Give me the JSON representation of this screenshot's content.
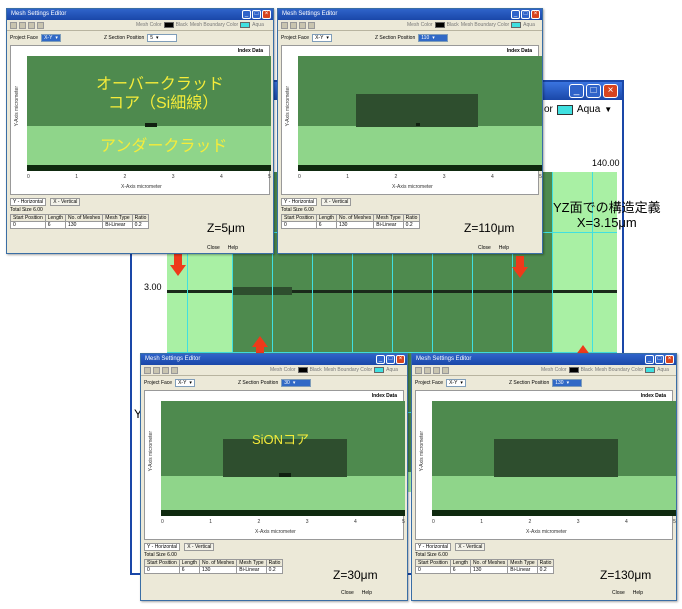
{
  "big_window": {
    "color_prefix": "or",
    "color_value": "Aqua",
    "color_hex": "#40e0e0",
    "axis_tick_right": "140.00",
    "axis_tick_left": "3.00",
    "side_letter": "Y",
    "annotation_line1": "YZ面での構造定義",
    "annotation_line2": "X=3.15μm"
  },
  "common": {
    "title": "Mesh Settings Editor",
    "toolbar_mesh_color": "Mesh Color",
    "toolbar_mesh_color_value": "Black",
    "toolbar_boundary_color": "Mesh Boundary Color",
    "toolbar_boundary_color_value": "Aqua",
    "project_face_label": "Project Face",
    "project_face_value": "X-Y",
    "zsection_label": "Z Section Position",
    "index_data": "Index Data",
    "y_axis_label": "Y-Axis micrometer",
    "x_axis_label": "X-Axis micrometer",
    "x_ticks": [
      "0",
      "1",
      "2",
      "3",
      "4",
      "5"
    ],
    "y_ticks": [
      "8",
      "7",
      "6",
      "5",
      "4",
      "3",
      "2",
      "1",
      "0"
    ],
    "tab_horizontal": "Y - Horizontal",
    "tab_vertical": "X - Vertical",
    "total_size_label": "Total Size",
    "total_size_value": "6.00",
    "columns": [
      "Start Position",
      "Length",
      "No. of Meshes",
      "Mesh Type",
      "Ratio"
    ],
    "row": [
      "0",
      "6",
      "130",
      "Bi-Linear",
      "0.2"
    ],
    "close_button": "Close",
    "help_button": "Help"
  },
  "windows": [
    {
      "id": "z5",
      "z_value": "5",
      "z_label": "Z=5μm",
      "overlay": [
        "オーバークラッド",
        "コア（Si細線）",
        "アンダークラッド"
      ]
    },
    {
      "id": "z110",
      "z_value": "110",
      "z_label": "Z=110μm",
      "overlay": []
    },
    {
      "id": "z30",
      "z_value": "30",
      "z_label": "Z=30μm",
      "overlay": [
        "SiONコア"
      ]
    },
    {
      "id": "z130",
      "z_value": "130",
      "z_label": "Z=130μm",
      "overlay": []
    }
  ],
  "colors": {
    "overclad": "#4e8a4e",
    "underclad": "#8fd58a",
    "core": "#2e4e2e",
    "substrate": "#0f2a0f",
    "overlay_text": "#f5ec3a",
    "arrow": "#ee3a1a"
  }
}
